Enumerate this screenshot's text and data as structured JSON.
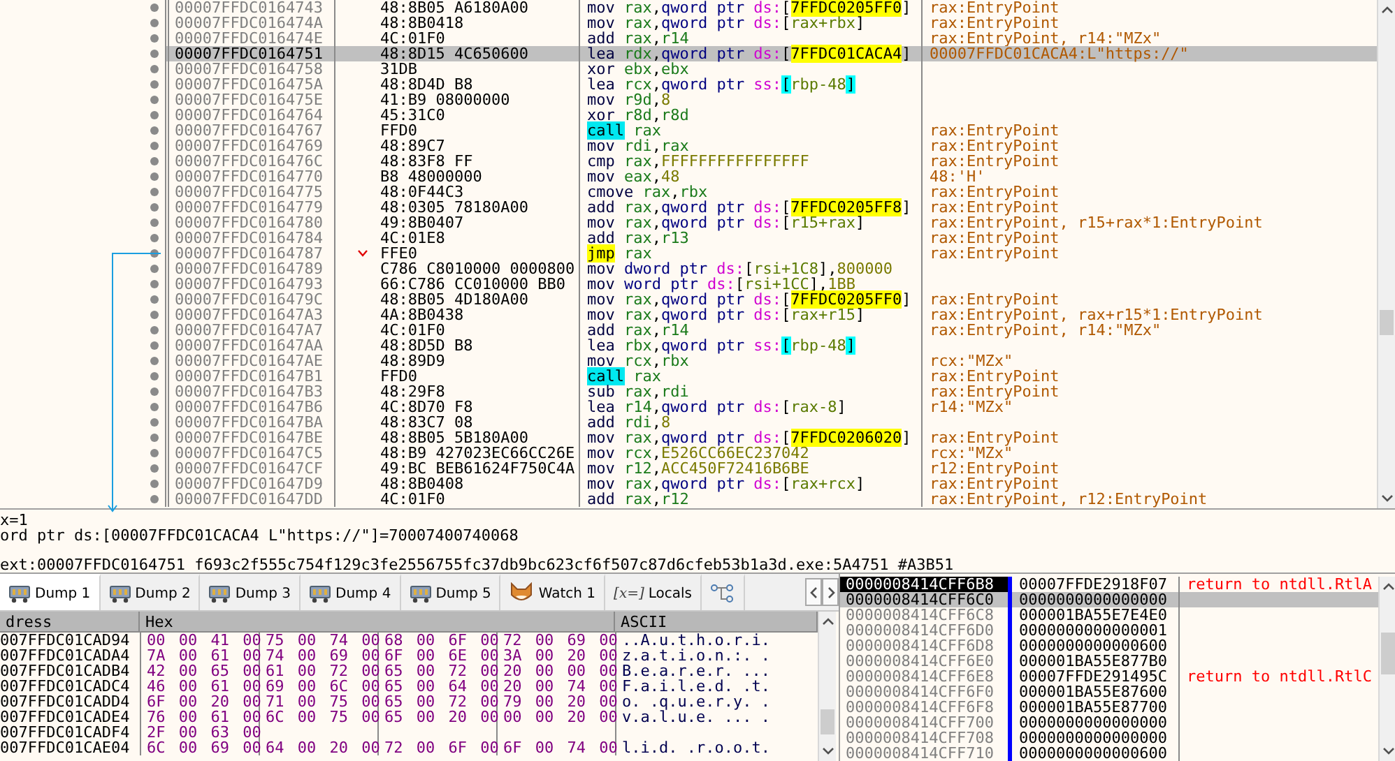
{
  "disassembly": {
    "rows": [
      {
        "address": "00007FFDC0164743",
        "bytes": "48:8B05 A6180A00",
        "instruction": [
          {
            "kind": "op",
            "text": "mov"
          },
          {
            "kind": "reg",
            "text": "rax"
          },
          {
            "kind": "sep",
            "text": ","
          },
          {
            "kind": "size",
            "text": "qword ptr"
          },
          {
            "kind": "seg",
            "text": "ds:"
          },
          {
            "kind": "brk",
            "text": "["
          },
          {
            "kind": "addr",
            "text": "7FFDC0205FF0"
          },
          {
            "kind": "brk",
            "text": "]"
          }
        ],
        "comment": "rax:EntryPoint",
        "selected": false,
        "jump": false
      },
      {
        "address": "00007FFDC016474A",
        "bytes": "48:8B0418",
        "instruction": [
          {
            "kind": "op",
            "text": "mov"
          },
          {
            "kind": "reg",
            "text": "rax"
          },
          {
            "kind": "sep",
            "text": ","
          },
          {
            "kind": "size",
            "text": "qword ptr"
          },
          {
            "kind": "seg",
            "text": "ds:"
          },
          {
            "kind": "brk",
            "text": "["
          },
          {
            "kind": "mem",
            "text": "rax+rbx"
          },
          {
            "kind": "brk",
            "text": "]"
          }
        ],
        "comment": "rax:EntryPoint",
        "selected": false,
        "jump": false
      },
      {
        "address": "00007FFDC016474E",
        "bytes": "4C:01F0",
        "instruction": [
          {
            "kind": "op",
            "text": "add"
          },
          {
            "kind": "reg",
            "text": "rax"
          },
          {
            "kind": "sep",
            "text": ","
          },
          {
            "kind": "reg",
            "text": "r14"
          }
        ],
        "comment": "rax:EntryPoint, r14:\"MZx\"",
        "selected": false,
        "jump": false
      },
      {
        "address": "00007FFDC0164751",
        "bytes": "48:8D15 4C650600",
        "instruction": [
          {
            "kind": "op",
            "text": "lea"
          },
          {
            "kind": "reg",
            "text": "rdx"
          },
          {
            "kind": "sep",
            "text": ","
          },
          {
            "kind": "size",
            "text": "qword ptr"
          },
          {
            "kind": "seg",
            "text": "ds:"
          },
          {
            "kind": "brk",
            "text": "["
          },
          {
            "kind": "addr",
            "text": "7FFDC01CACA4"
          },
          {
            "kind": "brk",
            "text": "]"
          }
        ],
        "comment": "00007FFDC01CACA4:L\"https://\"",
        "selected": true,
        "jump": false
      },
      {
        "address": "00007FFDC0164758",
        "bytes": "31DB",
        "instruction": [
          {
            "kind": "op",
            "text": "xor"
          },
          {
            "kind": "reg",
            "text": "ebx"
          },
          {
            "kind": "sep",
            "text": ","
          },
          {
            "kind": "reg",
            "text": "ebx"
          }
        ],
        "selected": false,
        "jump": false
      },
      {
        "address": "00007FFDC016475A",
        "bytes": "48:8D4D B8",
        "instruction": [
          {
            "kind": "op",
            "text": "lea"
          },
          {
            "kind": "reg",
            "text": "rcx"
          },
          {
            "kind": "sep",
            "text": ","
          },
          {
            "kind": "size",
            "text": "qword ptr"
          },
          {
            "kind": "seg",
            "text": "ss:"
          },
          {
            "kind": "sbrk",
            "text": "["
          },
          {
            "kind": "mem",
            "text": "rbp-48"
          },
          {
            "kind": "sbrk",
            "text": "]"
          }
        ],
        "selected": false,
        "jump": false
      },
      {
        "address": "00007FFDC016475E",
        "bytes": "41:B9 08000000",
        "instruction": [
          {
            "kind": "op",
            "text": "mov"
          },
          {
            "kind": "reg",
            "text": "r9d"
          },
          {
            "kind": "sep",
            "text": ","
          },
          {
            "kind": "num",
            "text": "8"
          }
        ],
        "selected": false,
        "jump": false
      },
      {
        "address": "00007FFDC0164764",
        "bytes": "45:31C0",
        "instruction": [
          {
            "kind": "op",
            "text": "xor"
          },
          {
            "kind": "reg",
            "text": "r8d"
          },
          {
            "kind": "sep",
            "text": ","
          },
          {
            "kind": "reg",
            "text": "r8d"
          }
        ],
        "selected": false,
        "jump": false
      },
      {
        "address": "00007FFDC0164767",
        "bytes": "FFD0",
        "instruction": [
          {
            "kind": "call",
            "text": "call"
          },
          {
            "kind": "reg",
            "text": "rax"
          }
        ],
        "comment": "rax:EntryPoint",
        "selected": false,
        "jump": false
      },
      {
        "address": "00007FFDC0164769",
        "bytes": "48:89C7",
        "instruction": [
          {
            "kind": "op",
            "text": "mov"
          },
          {
            "kind": "reg",
            "text": "rdi"
          },
          {
            "kind": "sep",
            "text": ","
          },
          {
            "kind": "reg",
            "text": "rax"
          }
        ],
        "comment": "rax:EntryPoint",
        "selected": false,
        "jump": false
      },
      {
        "address": "00007FFDC016476C",
        "bytes": "48:83F8 FF",
        "instruction": [
          {
            "kind": "op",
            "text": "cmp"
          },
          {
            "kind": "reg",
            "text": "rax"
          },
          {
            "kind": "sep",
            "text": ","
          },
          {
            "kind": "num",
            "text": "FFFFFFFFFFFFFFFF"
          }
        ],
        "comment": "rax:EntryPoint",
        "selected": false,
        "jump": false
      },
      {
        "address": "00007FFDC0164770",
        "bytes": "B8 48000000",
        "instruction": [
          {
            "kind": "op",
            "text": "mov"
          },
          {
            "kind": "reg",
            "text": "eax"
          },
          {
            "kind": "sep",
            "text": ","
          },
          {
            "kind": "num",
            "text": "48"
          }
        ],
        "comment": "48:'H'",
        "selected": false,
        "jump": false
      },
      {
        "address": "00007FFDC0164775",
        "bytes": "48:0F44C3",
        "instruction": [
          {
            "kind": "op",
            "text": "cmove"
          },
          {
            "kind": "reg",
            "text": "rax"
          },
          {
            "kind": "sep",
            "text": ","
          },
          {
            "kind": "reg",
            "text": "rbx"
          }
        ],
        "comment": "rax:EntryPoint",
        "selected": false,
        "jump": false
      },
      {
        "address": "00007FFDC0164779",
        "bytes": "48:0305 78180A00",
        "instruction": [
          {
            "kind": "op",
            "text": "add"
          },
          {
            "kind": "reg",
            "text": "rax"
          },
          {
            "kind": "sep",
            "text": ","
          },
          {
            "kind": "size",
            "text": "qword ptr"
          },
          {
            "kind": "seg",
            "text": "ds:"
          },
          {
            "kind": "brk",
            "text": "["
          },
          {
            "kind": "addr",
            "text": "7FFDC0205FF8"
          },
          {
            "kind": "brk",
            "text": "]"
          }
        ],
        "comment": "rax:EntryPoint",
        "selected": false,
        "jump": false
      },
      {
        "address": "00007FFDC0164780",
        "bytes": "49:8B0407",
        "instruction": [
          {
            "kind": "op",
            "text": "mov"
          },
          {
            "kind": "reg",
            "text": "rax"
          },
          {
            "kind": "sep",
            "text": ","
          },
          {
            "kind": "size",
            "text": "qword ptr"
          },
          {
            "kind": "seg",
            "text": "ds:"
          },
          {
            "kind": "brk",
            "text": "["
          },
          {
            "kind": "mem",
            "text": "r15+rax"
          },
          {
            "kind": "brk",
            "text": "]"
          }
        ],
        "comment": "rax:EntryPoint, r15+rax*1:EntryPoint",
        "selected": false,
        "jump": false
      },
      {
        "address": "00007FFDC0164784",
        "bytes": "4C:01E8",
        "instruction": [
          {
            "kind": "op",
            "text": "add"
          },
          {
            "kind": "reg",
            "text": "rax"
          },
          {
            "kind": "sep",
            "text": ","
          },
          {
            "kind": "reg",
            "text": "r13"
          }
        ],
        "comment": "rax:EntryPoint",
        "selected": false,
        "jump": false
      },
      {
        "address": "00007FFDC0164787",
        "bytes": "FFE0",
        "instruction": [
          {
            "kind": "jmp",
            "text": "jmp"
          },
          {
            "kind": "reg",
            "text": "rax"
          }
        ],
        "comment": "rax:EntryPoint",
        "selected": false,
        "jump": true
      },
      {
        "address": "00007FFDC0164789",
        "bytes": "C786 C8010000 0000800",
        "instruction": [
          {
            "kind": "op",
            "text": "mov"
          },
          {
            "kind": "size",
            "text": "dword ptr"
          },
          {
            "kind": "seg",
            "text": "ds:"
          },
          {
            "kind": "brk",
            "text": "["
          },
          {
            "kind": "mem",
            "text": "rsi+1C8"
          },
          {
            "kind": "brk",
            "text": "]"
          },
          {
            "kind": "sep",
            "text": ","
          },
          {
            "kind": "num",
            "text": "800000"
          }
        ],
        "selected": false,
        "jump": false
      },
      {
        "address": "00007FFDC0164793",
        "bytes": "66:C786 CC010000 BB0",
        "instruction": [
          {
            "kind": "op",
            "text": "mov"
          },
          {
            "kind": "size",
            "text": "word ptr"
          },
          {
            "kind": "seg",
            "text": "ds:"
          },
          {
            "kind": "brk",
            "text": "["
          },
          {
            "kind": "mem",
            "text": "rsi+1CC"
          },
          {
            "kind": "brk",
            "text": "]"
          },
          {
            "kind": "sep",
            "text": ","
          },
          {
            "kind": "num",
            "text": "1BB"
          }
        ],
        "selected": false,
        "jump": false
      },
      {
        "address": "00007FFDC016479C",
        "bytes": "48:8B05 4D180A00",
        "instruction": [
          {
            "kind": "op",
            "text": "mov"
          },
          {
            "kind": "reg",
            "text": "rax"
          },
          {
            "kind": "sep",
            "text": ","
          },
          {
            "kind": "size",
            "text": "qword ptr"
          },
          {
            "kind": "seg",
            "text": "ds:"
          },
          {
            "kind": "brk",
            "text": "["
          },
          {
            "kind": "addr",
            "text": "7FFDC0205FF0"
          },
          {
            "kind": "brk",
            "text": "]"
          }
        ],
        "comment": "rax:EntryPoint",
        "selected": false,
        "jump": false
      },
      {
        "address": "00007FFDC01647A3",
        "bytes": "4A:8B0438",
        "instruction": [
          {
            "kind": "op",
            "text": "mov"
          },
          {
            "kind": "reg",
            "text": "rax"
          },
          {
            "kind": "sep",
            "text": ","
          },
          {
            "kind": "size",
            "text": "qword ptr"
          },
          {
            "kind": "seg",
            "text": "ds:"
          },
          {
            "kind": "brk",
            "text": "["
          },
          {
            "kind": "mem",
            "text": "rax+r15"
          },
          {
            "kind": "brk",
            "text": "]"
          }
        ],
        "comment": "rax:EntryPoint, rax+r15*1:EntryPoint",
        "selected": false,
        "jump": false
      },
      {
        "address": "00007FFDC01647A7",
        "bytes": "4C:01F0",
        "instruction": [
          {
            "kind": "op",
            "text": "add"
          },
          {
            "kind": "reg",
            "text": "rax"
          },
          {
            "kind": "sep",
            "text": ","
          },
          {
            "kind": "reg",
            "text": "r14"
          }
        ],
        "comment": "rax:EntryPoint, r14:\"MZx\"",
        "selected": false,
        "jump": false
      },
      {
        "address": "00007FFDC01647AA",
        "bytes": "48:8D5D B8",
        "instruction": [
          {
            "kind": "op",
            "text": "lea"
          },
          {
            "kind": "reg",
            "text": "rbx"
          },
          {
            "kind": "sep",
            "text": ","
          },
          {
            "kind": "size",
            "text": "qword ptr"
          },
          {
            "kind": "seg",
            "text": "ss:"
          },
          {
            "kind": "sbrk",
            "text": "["
          },
          {
            "kind": "mem",
            "text": "rbp-48"
          },
          {
            "kind": "sbrk",
            "text": "]"
          }
        ],
        "selected": false,
        "jump": false
      },
      {
        "address": "00007FFDC01647AE",
        "bytes": "48:89D9",
        "instruction": [
          {
            "kind": "op",
            "text": "mov"
          },
          {
            "kind": "reg",
            "text": "rcx"
          },
          {
            "kind": "sep",
            "text": ","
          },
          {
            "kind": "reg",
            "text": "rbx"
          }
        ],
        "comment": "rcx:\"MZx\"",
        "selected": false,
        "jump": false
      },
      {
        "address": "00007FFDC01647B1",
        "bytes": "FFD0",
        "instruction": [
          {
            "kind": "call",
            "text": "call"
          },
          {
            "kind": "reg",
            "text": "rax"
          }
        ],
        "comment": "rax:EntryPoint",
        "selected": false,
        "jump": false
      },
      {
        "address": "00007FFDC01647B3",
        "bytes": "48:29F8",
        "instruction": [
          {
            "kind": "op",
            "text": "sub"
          },
          {
            "kind": "reg",
            "text": "rax"
          },
          {
            "kind": "sep",
            "text": ","
          },
          {
            "kind": "reg",
            "text": "rdi"
          }
        ],
        "comment": "rax:EntryPoint",
        "selected": false,
        "jump": false
      },
      {
        "address": "00007FFDC01647B6",
        "bytes": "4C:8D70 F8",
        "instruction": [
          {
            "kind": "op",
            "text": "lea"
          },
          {
            "kind": "reg",
            "text": "r14"
          },
          {
            "kind": "sep",
            "text": ","
          },
          {
            "kind": "size",
            "text": "qword ptr"
          },
          {
            "kind": "seg",
            "text": "ds:"
          },
          {
            "kind": "brk",
            "text": "["
          },
          {
            "kind": "mem",
            "text": "rax-8"
          },
          {
            "kind": "brk",
            "text": "]"
          }
        ],
        "comment": "r14:\"MZx\"",
        "selected": false,
        "jump": false
      },
      {
        "address": "00007FFDC01647BA",
        "bytes": "48:83C7 08",
        "instruction": [
          {
            "kind": "op",
            "text": "add"
          },
          {
            "kind": "reg",
            "text": "rdi"
          },
          {
            "kind": "sep",
            "text": ","
          },
          {
            "kind": "num",
            "text": "8"
          }
        ],
        "selected": false,
        "jump": false
      },
      {
        "address": "00007FFDC01647BE",
        "bytes": "48:8B05 5B180A00",
        "instruction": [
          {
            "kind": "op",
            "text": "mov"
          },
          {
            "kind": "reg",
            "text": "rax"
          },
          {
            "kind": "sep",
            "text": ","
          },
          {
            "kind": "size",
            "text": "qword ptr"
          },
          {
            "kind": "seg",
            "text": "ds:"
          },
          {
            "kind": "brk",
            "text": "["
          },
          {
            "kind": "addr",
            "text": "7FFDC0206020"
          },
          {
            "kind": "brk",
            "text": "]"
          }
        ],
        "comment": "rax:EntryPoint",
        "selected": false,
        "jump": false
      },
      {
        "address": "00007FFDC01647C5",
        "bytes": "48:B9 427023EC66CC26E",
        "instruction": [
          {
            "kind": "op",
            "text": "mov"
          },
          {
            "kind": "reg",
            "text": "rcx"
          },
          {
            "kind": "sep",
            "text": ","
          },
          {
            "kind": "num",
            "text": "E526CC66EC237042"
          }
        ],
        "comment": "rcx:\"MZx\"",
        "selected": false,
        "jump": false
      },
      {
        "address": "00007FFDC01647CF",
        "bytes": "49:BC BEB61624F750C4A",
        "instruction": [
          {
            "kind": "op",
            "text": "mov"
          },
          {
            "kind": "reg",
            "text": "r12"
          },
          {
            "kind": "sep",
            "text": ","
          },
          {
            "kind": "num",
            "text": "ACC450F72416B6BE"
          }
        ],
        "comment": "r12:EntryPoint",
        "selected": false,
        "jump": false
      },
      {
        "address": "00007FFDC01647D9",
        "bytes": "48:8B0408",
        "instruction": [
          {
            "kind": "op",
            "text": "mov"
          },
          {
            "kind": "reg",
            "text": "rax"
          },
          {
            "kind": "sep",
            "text": ","
          },
          {
            "kind": "size",
            "text": "qword ptr"
          },
          {
            "kind": "seg",
            "text": "ds:"
          },
          {
            "kind": "brk",
            "text": "["
          },
          {
            "kind": "mem",
            "text": "rax+rcx"
          },
          {
            "kind": "brk",
            "text": "]"
          }
        ],
        "comment": "rax:EntryPoint",
        "selected": false,
        "jump": false
      },
      {
        "address": "00007FFDC01647DD",
        "bytes": "4C:01F0",
        "instruction": [
          {
            "kind": "op",
            "text": "add"
          },
          {
            "kind": "reg",
            "text": "rax"
          },
          {
            "kind": "sep",
            "text": ","
          },
          {
            "kind": "reg",
            "text": "r12"
          }
        ],
        "comment": "rax:EntryPoint, r12:EntryPoint",
        "selected": false,
        "jump": false
      }
    ]
  },
  "info": {
    "lines": [
      "x=1",
      "ord ptr ds:[00007FFDC01CACA4 L\"https://\"]=70007400740068"
    ],
    "reference": "ext:00007FFDC0164751 f693c2f555c754f129c3fe2556755fc37db9bc623cf6f507c87d6cfeb53b1a3d.exe:5A4751 #A3B51"
  },
  "tabs": [
    {
      "label": "Dump 1",
      "kind": "dump",
      "selected": true
    },
    {
      "label": "Dump 2",
      "kind": "dump",
      "selected": false
    },
    {
      "label": "Dump 3",
      "kind": "dump",
      "selected": false
    },
    {
      "label": "Dump 4",
      "kind": "dump",
      "selected": false
    },
    {
      "label": "Dump 5",
      "kind": "dump",
      "selected": false
    },
    {
      "label": "Watch 1",
      "kind": "watch",
      "selected": false
    },
    {
      "label": "Locals",
      "glyph": "[x=]",
      "kind": "locals",
      "selected": false
    },
    {
      "kind": "graph",
      "selected": false
    }
  ],
  "dump": {
    "columns": [
      "dress",
      "Hex",
      "ASCII"
    ],
    "rows": [
      {
        "address": "007FFDC01CAD94",
        "hex": [
          "00 00 41 00",
          "75 00 74 00",
          "68 00 6F 00",
          "72 00 69 00"
        ],
        "ascii": "..A.u.t.h.o.r.i."
      },
      {
        "address": "007FFDC01CADA4",
        "hex": [
          "7A 00 61 00",
          "74 00 69 00",
          "6F 00 6E 00",
          "3A 00 20 00"
        ],
        "ascii": "z.a.t.i.o.n.:. ."
      },
      {
        "address": "007FFDC01CADB4",
        "hex": [
          "42 00 65 00",
          "61 00 72 00",
          "65 00 72 00",
          "20 00 00 00"
        ],
        "ascii": "B.e.a.r.e.r. ..."
      },
      {
        "address": "007FFDC01CADC4",
        "hex": [
          "46 00 61 00",
          "69 00 6C 00",
          "65 00 64 00",
          "20 00 74 00"
        ],
        "ascii": "F.a.i.l.e.d. .t."
      },
      {
        "address": "007FFDC01CADD4",
        "hex": [
          "6F 00 20 00",
          "71 00 75 00",
          "65 00 72 00",
          "79 00 20 00"
        ],
        "ascii": "o. .q.u.e.r.y. ."
      },
      {
        "address": "007FFDC01CADE4",
        "hex": [
          "76 00 61 00",
          "6C 00 75 00",
          "65 00 20 00",
          "00 00 20 00"
        ],
        "ascii": "v.a.l.u.e. ... ."
      },
      {
        "address": "007FFDC01CADF4",
        "hex": [
          "2F 00 63 00"
        ]
      },
      {
        "address": "007FFDC01CAE04",
        "hex": [
          "6C 00 69 00",
          "64 00 20 00",
          "72 00 6F 00",
          "6F 00 74 00"
        ],
        "ascii": "l.i.d. .r.o.o.t."
      }
    ]
  },
  "stack": {
    "rows": [
      {
        "address": "0000008414CFF6B8",
        "value": "00007FFDE2918F07",
        "comment": "return to ntdll.RtlA",
        "current": true,
        "selected": false
      },
      {
        "address": "0000008414CFF6C0",
        "value": "0000000000000000",
        "current": false,
        "selected": true
      },
      {
        "address": "0000008414CFF6C8",
        "value": "000001BA55E7E4E0",
        "current": false,
        "selected": false
      },
      {
        "address": "0000008414CFF6D0",
        "value": "0000000000000001",
        "current": false,
        "selected": false
      },
      {
        "address": "0000008414CFF6D8",
        "value": "0000000000000600",
        "current": false,
        "selected": false
      },
      {
        "address": "0000008414CFF6E0",
        "value": "000001BA55E877B0",
        "current": false,
        "selected": false
      },
      {
        "address": "0000008414CFF6E8",
        "value": "00007FFDE291495C",
        "comment": "return to ntdll.RtlC",
        "current": false,
        "selected": false
      },
      {
        "address": "0000008414CFF6F0",
        "value": "000001BA55E87600",
        "current": false,
        "selected": false
      },
      {
        "address": "0000008414CFF6F8",
        "value": "000001BA55E87700",
        "current": false,
        "selected": false
      },
      {
        "address": "0000008414CFF700",
        "value": "0000000000000000",
        "current": false,
        "selected": false
      },
      {
        "address": "0000008414CFF708",
        "value": "0000000000000000",
        "current": false,
        "selected": false
      },
      {
        "address": "0000008414CFF710",
        "value": "0000000000000600",
        "current": false,
        "selected": false
      }
    ]
  }
}
